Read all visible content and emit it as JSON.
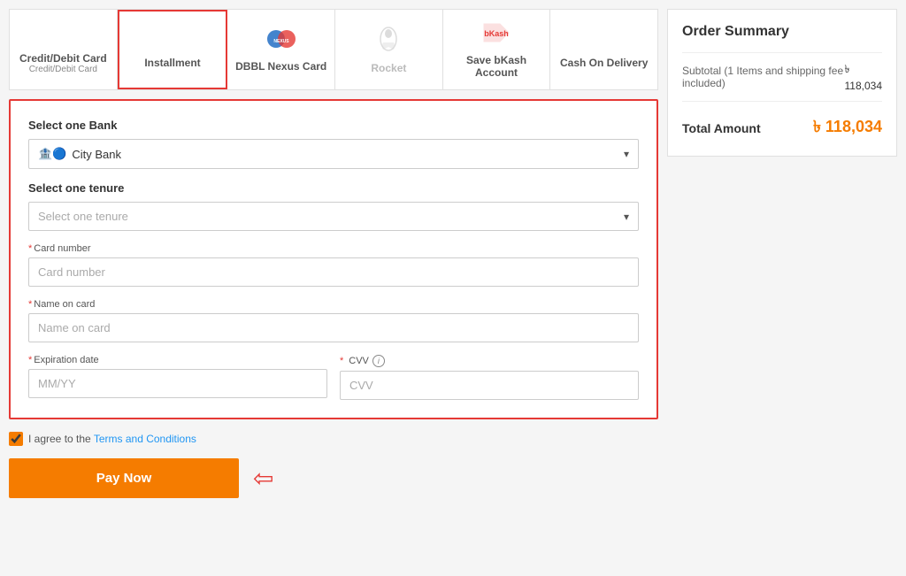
{
  "tabs": [
    {
      "id": "credit-debit",
      "label": "Credit/Debit Card",
      "sublabel": "Credit/Debit Card",
      "active": false,
      "disabled": false,
      "icon": "credit-card"
    },
    {
      "id": "installment",
      "label": "Installment",
      "sublabel": "",
      "active": true,
      "disabled": false,
      "icon": "installment"
    },
    {
      "id": "dbbl",
      "label": "DBBL Nexus Card",
      "sublabel": "",
      "active": false,
      "disabled": false,
      "icon": "dbbl"
    },
    {
      "id": "rocket",
      "label": "Rocket",
      "sublabel": "",
      "active": false,
      "disabled": true,
      "icon": "rocket"
    },
    {
      "id": "bkash",
      "label": "Save bKash Account",
      "sublabel": "",
      "active": false,
      "disabled": false,
      "icon": "bkash"
    },
    {
      "id": "cod",
      "label": "Cash On Delivery",
      "sublabel": "",
      "active": false,
      "disabled": false,
      "icon": "cod"
    }
  ],
  "form": {
    "select_bank_label": "Select one Bank",
    "selected_bank": "City Bank",
    "bank_placeholder": "City Bank",
    "select_tenure_label": "Select one tenure",
    "tenure_placeholder": "Select one tenure",
    "card_number_label": "Card number",
    "card_number_placeholder": "Card number",
    "name_on_card_label": "Name on card",
    "name_on_card_placeholder": "Name on card",
    "expiration_date_label": "Expiration date",
    "expiration_date_placeholder": "MM/YY",
    "cvv_label": "CVV",
    "cvv_placeholder": "CVV"
  },
  "terms": {
    "text": "I agree to the ",
    "link_text": "Terms and Conditions"
  },
  "pay_button_label": "Pay Now",
  "order_summary": {
    "title": "Order Summary",
    "subtotal_label": "Subtotal (1 Items and shipping fee included)",
    "subtotal_amount": "৳ 118,034",
    "total_label": "Total Amount",
    "total_amount": "৳ 118,034"
  }
}
